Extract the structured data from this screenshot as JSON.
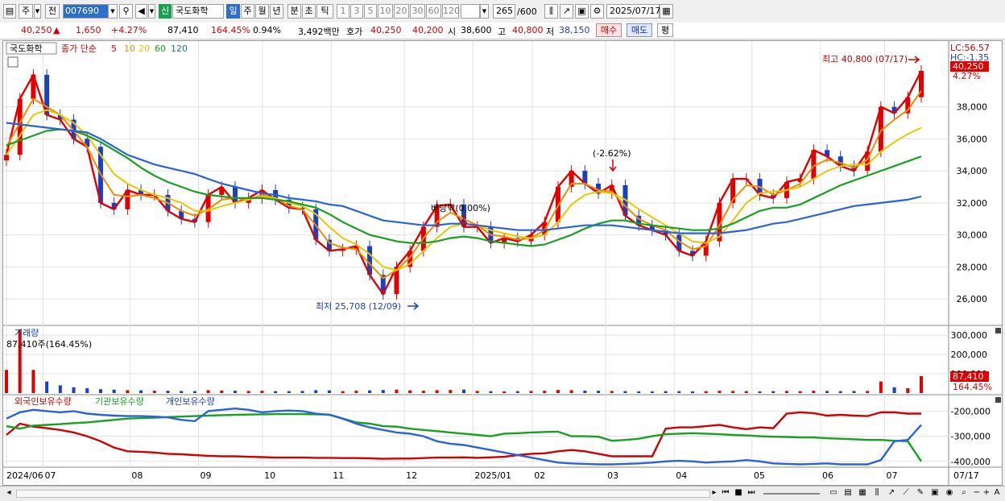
{
  "toolbar": {
    "period_type": "주",
    "prev_label": "전",
    "code": "007690",
    "credit_badge": "신",
    "stock_name": "국도화학",
    "period_buttons": [
      "일",
      "주",
      "월",
      "년",
      "분",
      "초",
      "틱"
    ],
    "selected_period": "일",
    "minute_buttons": [
      "1",
      "3",
      "5",
      "10",
      "20",
      "30",
      "60",
      "120"
    ],
    "bar_count": "265",
    "bar_total": "/600",
    "date": "2025/07/17"
  },
  "quote": {
    "price": "40,250",
    "arrow": "▲",
    "change": "1,650",
    "change_pct": "+4.27%",
    "volume": "87,410",
    "volume_ratio": "164.45%",
    "turnover": "0.94%",
    "amount": "3,492백만",
    "ask_label": "호가",
    "ask": "40,250",
    "bid": "40,200",
    "open_label": "시",
    "open": "38,600",
    "high_label": "고",
    "high": "40,800",
    "low_label": "저",
    "low": "38,150",
    "buy_label": "매수",
    "sell_label": "매도",
    "eval_label": "평"
  },
  "price_panel": {
    "stock_label": "국도화학",
    "ma_label": "종가 단순",
    "ma_periods": [
      {
        "text": "5",
        "color": "#e00000"
      },
      {
        "text": "10",
        "color": "#f08c00"
      },
      {
        "text": "20",
        "color": "#e6c800"
      },
      {
        "text": "60",
        "color": "#18a020"
      },
      {
        "text": "120",
        "color": "#2a62d8"
      }
    ],
    "lc": "LC:56.57",
    "hc": "HC:-1.35",
    "last_price": "40,250",
    "last_pct": "4.27%",
    "high_annotation": "최고 40,800 (07/17)",
    "low_annotation": "최저 25,708 (12/09)",
    "dividend_annotation": "배당락(0.00%)",
    "pct_annotation": "(-2.62%)",
    "y_ticks": [
      "38,000",
      "36,000",
      "34,000",
      "32,000",
      "30,000",
      "28,000",
      "26,000"
    ]
  },
  "volume_panel": {
    "title": "거래량",
    "value_label": "87,410주(164.45%)",
    "last": "87,410",
    "last_pct": "164.45%",
    "y_ticks": [
      "300,000",
      "200,000",
      "100,000"
    ]
  },
  "holding_panel": {
    "foreign": "외국인보유수량",
    "institution": "기관보유수량",
    "individual": "개인보유수량",
    "y_ticks": [
      "-200,000",
      "-300,000",
      "-400,000"
    ]
  },
  "x_axis": [
    "2024/06",
    "07",
    "08",
    "09",
    "10",
    "11",
    "12",
    "2025/01",
    "02",
    "03",
    "04",
    "05",
    "06",
    "07",
    "07/17"
  ],
  "chart_data": [
    {
      "type": "line",
      "title": "",
      "series": [
        {
          "name": "종가",
          "values": [
            35000,
            38500,
            40000,
            37500,
            37200,
            36000,
            35500,
            32000,
            31600,
            32800,
            32500,
            32500,
            31500,
            31000,
            30800,
            32500,
            33000,
            32000,
            32300,
            32800,
            32200,
            31700,
            31600,
            29700,
            29000,
            29100,
            29300,
            27500,
            26300,
            28000,
            29000,
            30500,
            31800,
            31900,
            30500,
            30500,
            29500,
            29800,
            29600,
            30000,
            30800,
            33000,
            34000,
            33200,
            32600,
            33100,
            31200,
            30600,
            30300,
            30000,
            29000,
            28700,
            29600,
            32000,
            33500,
            33500,
            32500,
            32300,
            33300,
            33500,
            35300,
            34900,
            34300,
            34000,
            35200,
            38000,
            37600,
            38600,
            40250
          ]
        },
        {
          "name": "10",
          "values": [
            35500,
            37000,
            38500,
            38000,
            37500,
            36500,
            35500,
            33800,
            32500,
            32400,
            32500,
            32300,
            32000,
            31500,
            31200,
            31600,
            32200,
            32300,
            32200,
            32500,
            32300,
            31800,
            31600,
            30600,
            29500,
            29200,
            29100,
            28200,
            27300,
            27800,
            28600,
            29800,
            30800,
            31400,
            31000,
            30600,
            30000,
            29900,
            29700,
            29800,
            30300,
            31800,
            33200,
            33200,
            32800,
            32700,
            31800,
            31000,
            30600,
            30300,
            29600,
            29100,
            29300,
            30600,
            32200,
            33100,
            33000,
            32500,
            32800,
            33200,
            34300,
            34700,
            34500,
            34200,
            34700,
            36500,
            37200,
            37800,
            39000
          ]
        },
        {
          "name": "20",
          "values": [
            35000,
            36200,
            37500,
            37800,
            37500,
            37000,
            36200,
            35000,
            33800,
            33200,
            32800,
            32500,
            32300,
            32000,
            31500,
            31500,
            31800,
            32000,
            32200,
            32400,
            32300,
            32000,
            31800,
            31300,
            30500,
            29800,
            29400,
            28800,
            28000,
            27800,
            28200,
            29000,
            29800,
            30500,
            30700,
            30600,
            30300,
            30100,
            29900,
            29800,
            30000,
            30800,
            31900,
            32500,
            32700,
            32600,
            32200,
            31600,
            31100,
            30600,
            30100,
            29600,
            29500,
            29900,
            30900,
            32000,
            32600,
            32700,
            32800,
            33000,
            33500,
            34000,
            34300,
            34400,
            34400,
            35200,
            35800,
            36300,
            36700
          ]
        },
        {
          "name": "60",
          "values": [
            35600,
            35900,
            36200,
            36500,
            36600,
            36500,
            36200,
            35800,
            35300,
            34800,
            34200,
            33700,
            33300,
            33000,
            32700,
            32500,
            32400,
            32300,
            32300,
            32300,
            32200,
            32100,
            31900,
            31700,
            31300,
            30800,
            30400,
            30000,
            29800,
            29600,
            29500,
            29500,
            29600,
            29800,
            29900,
            29800,
            29600,
            29500,
            29400,
            29300,
            29400,
            29700,
            30000,
            30400,
            30700,
            30900,
            30900,
            30700,
            30600,
            30500,
            30400,
            30300,
            30300,
            30400,
            30700,
            31100,
            31500,
            31700,
            31700,
            31900,
            32300,
            32700,
            33100,
            33400,
            33700,
            34000,
            34300,
            34600,
            34900
          ]
        },
        {
          "name": "120",
          "values": [
            37000,
            36900,
            36800,
            36700,
            36600,
            36500,
            36400,
            36000,
            35500,
            35000,
            34700,
            34400,
            34200,
            34000,
            33800,
            33500,
            33200,
            33000,
            32800,
            32600,
            32500,
            32300,
            32200,
            32100,
            31900,
            31800,
            31500,
            31200,
            30900,
            30800,
            30700,
            30600,
            30600,
            30700,
            30700,
            30600,
            30500,
            30400,
            30300,
            30300,
            30300,
            30400,
            30500,
            30600,
            30600,
            30600,
            30500,
            30400,
            30300,
            30200,
            30100,
            30100,
            30100,
            30100,
            30200,
            30300,
            30500,
            30700,
            30800,
            31000,
            31200,
            31400,
            31600,
            31800,
            31900,
            32000,
            32100,
            32200,
            32400
          ]
        }
      ],
      "ylim": [
        25000,
        41000
      ]
    },
    {
      "type": "bar",
      "title": "거래량",
      "values": [
        120000,
        330000,
        120000,
        60000,
        40000,
        30000,
        25000,
        20000,
        18000,
        15000,
        14000,
        12000,
        12000,
        11000,
        10000,
        15000,
        13000,
        12000,
        11000,
        12000,
        10000,
        10000,
        11000,
        15000,
        14000,
        10000,
        12000,
        14000,
        16000,
        18000,
        14000,
        12000,
        15000,
        16000,
        18000,
        11000,
        10000,
        9000,
        10000,
        11000,
        12000,
        16000,
        15000,
        13000,
        12000,
        11000,
        10000,
        9000,
        9000,
        10000,
        10000,
        9000,
        10000,
        12000,
        11000,
        10000,
        9000,
        10000,
        11000,
        10000,
        12000,
        11000,
        10000,
        11000,
        11000,
        60000,
        30000,
        25000,
        87410
      ],
      "ylim": [
        0,
        330000
      ]
    },
    {
      "type": "line",
      "title": "",
      "series": [
        {
          "name": "외국인보유수량",
          "values": [
            -295000,
            -250000,
            -262000,
            -268000,
            -275000,
            -285000,
            -300000,
            -320000,
            -345000,
            -360000,
            -362000,
            -365000,
            -370000,
            -372000,
            -375000,
            -378000,
            -380000,
            -380000,
            -382000,
            -383000,
            -385000,
            -385000,
            -385000,
            -386000,
            -386000,
            -387000,
            -387000,
            -388000,
            -390000,
            -389000,
            -389000,
            -387000,
            -385000,
            -385000,
            -384000,
            -386000,
            -384000,
            -382000,
            -375000,
            -370000,
            -368000,
            -360000,
            -355000,
            -360000,
            -370000,
            -380000,
            -380000,
            -380000,
            -380000,
            -270000,
            -265000,
            -265000,
            -260000,
            -255000,
            -265000,
            -272000,
            -265000,
            -268000,
            -210000,
            -205000,
            -208000,
            -218000,
            -215000,
            -218000,
            -220000,
            -205000,
            -205000,
            -210000,
            -210000
          ]
        },
        {
          "name": "기관보유수량",
          "values": [
            -260000,
            -270000,
            -258000,
            -255000,
            -252000,
            -248000,
            -245000,
            -240000,
            -235000,
            -230000,
            -228000,
            -226000,
            -224000,
            -222000,
            -220000,
            -218000,
            -216000,
            -215000,
            -214000,
            -213000,
            -212000,
            -212000,
            -212000,
            -213000,
            -214000,
            -230000,
            -245000,
            -250000,
            -260000,
            -262000,
            -270000,
            -275000,
            -280000,
            -285000,
            -290000,
            -295000,
            -300000,
            -290000,
            -288000,
            -285000,
            -283000,
            -282000,
            -300000,
            -300000,
            -302000,
            -318000,
            -315000,
            -310000,
            -300000,
            -292000,
            -290000,
            -288000,
            -290000,
            -292000,
            -295000,
            -297000,
            -300000,
            -302000,
            -303000,
            -305000,
            -305000,
            -308000,
            -310000,
            -312000,
            -315000,
            -315000,
            -318000,
            -320000,
            -400000
          ]
        },
        {
          "name": "개인보유수량",
          "values": [
            -230000,
            -205000,
            -195000,
            -200000,
            -205000,
            -200000,
            -210000,
            -215000,
            -218000,
            -220000,
            -220000,
            -222000,
            -225000,
            -235000,
            -240000,
            -200000,
            -195000,
            -190000,
            -195000,
            -205000,
            -200000,
            -198000,
            -200000,
            -210000,
            -215000,
            -230000,
            -250000,
            -265000,
            -275000,
            -285000,
            -290000,
            -300000,
            -320000,
            -330000,
            -335000,
            -345000,
            -355000,
            -365000,
            -375000,
            -385000,
            -395000,
            -405000,
            -408000,
            -410000,
            -412000,
            -412000,
            -410000,
            -408000,
            -405000,
            -400000,
            -398000,
            -400000,
            -405000,
            -402000,
            -400000,
            -395000,
            -400000,
            -408000,
            -410000,
            -412000,
            -410000,
            -408000,
            -412000,
            -412000,
            -412000,
            -395000,
            -320000,
            -315000,
            -255000
          ]
        }
      ],
      "ylim": [
        -420000,
        -170000
      ]
    }
  ]
}
